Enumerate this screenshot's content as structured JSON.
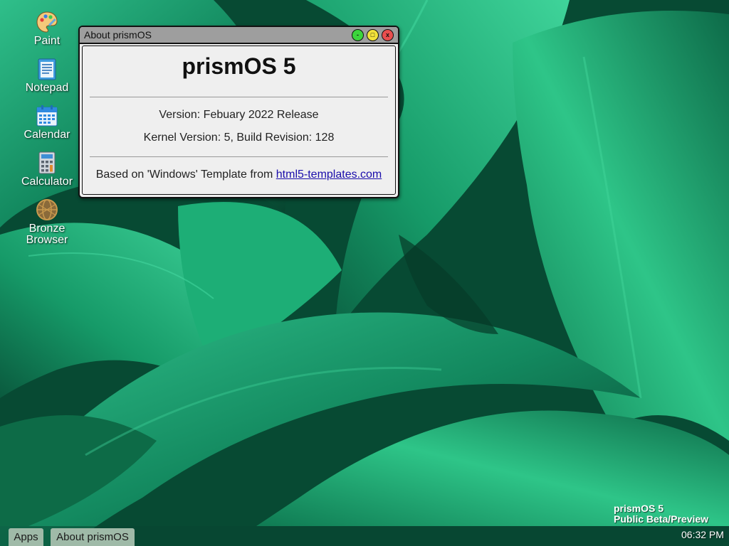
{
  "desktop": {
    "icons": [
      {
        "label": "Paint",
        "icon": "paint-palette-icon"
      },
      {
        "label": "Notepad",
        "icon": "notepad-icon"
      },
      {
        "label": "Calendar",
        "icon": "calendar-icon"
      },
      {
        "label": "Calculator",
        "icon": "calculator-icon"
      },
      {
        "label": "Bronze Browser",
        "icon": "globe-icon"
      }
    ]
  },
  "window": {
    "title": "About prismOS",
    "buttons": {
      "minimize": "-",
      "maximize": "□",
      "close": "x"
    },
    "heading": "prismOS 5",
    "version": "Version: Febuary 2022 Release",
    "kernel": "Kernel Version: 5, Build Revision: 128",
    "based_text": "Based on 'Windows' Template from ",
    "based_link": "html5-templates.com"
  },
  "branding": {
    "line1": "prismOS 5",
    "line2": "Public Beta/Preview"
  },
  "taskbar": {
    "apps_label": "Apps",
    "open_window": "About prismOS",
    "clock": "06:32 PM"
  },
  "colors": {
    "window_bg": "#efefef",
    "titlebar_bg": "#9e9e9e",
    "minimize": "#3cd43c",
    "maximize": "#f2e23a",
    "close": "#e94e4e",
    "link": "#1a0dab",
    "taskbar_button": "#9fbaa8"
  }
}
